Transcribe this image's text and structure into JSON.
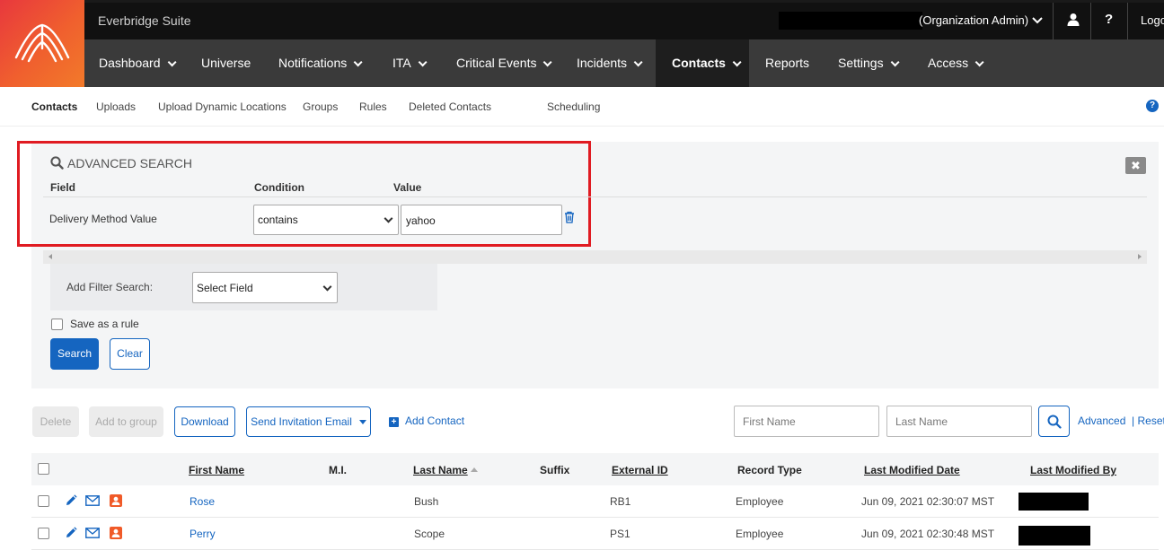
{
  "app": {
    "suite_title": "Everbridge Suite",
    "role_label": "(Organization Admin)",
    "logout_label": "Logo",
    "help_label": "?"
  },
  "nav": {
    "items": [
      {
        "label": "Dashboard",
        "caret": true
      },
      {
        "label": "Universe",
        "caret": false
      },
      {
        "label": "Notifications",
        "caret": true
      },
      {
        "label": "ITA",
        "caret": true
      },
      {
        "label": "Critical Events",
        "caret": true
      },
      {
        "label": "Incidents",
        "caret": true
      },
      {
        "label": "Contacts",
        "caret": true,
        "active": true
      },
      {
        "label": "Reports",
        "caret": false
      },
      {
        "label": "Settings",
        "caret": true
      },
      {
        "label": "Access",
        "caret": true
      }
    ]
  },
  "subnav": {
    "items": [
      "Contacts",
      "Uploads",
      "Upload Dynamic Locations",
      "Groups",
      "Rules",
      "Deleted Contacts",
      "Scheduling"
    ],
    "active": "Contacts",
    "help": "?"
  },
  "advanced_search": {
    "title": "ADVANCED SEARCH",
    "close": "✖",
    "headers": {
      "field": "Field",
      "condition": "Condition",
      "value": "Value"
    },
    "row": {
      "field": "Delivery Method Value",
      "condition": "contains",
      "value": "yahoo"
    },
    "add_filter_label": "Add Filter Search:",
    "add_filter_select": "Select Field",
    "save_rule_label": "Save as a rule",
    "search_button": "Search",
    "clear_button": "Clear"
  },
  "toolbar": {
    "delete": "Delete",
    "add_to_group": "Add to group",
    "download": "Download",
    "send_invitation": "Send Invitation Email",
    "add_contact": "Add Contact",
    "first_name_placeholder": "First Name",
    "last_name_placeholder": "Last Name",
    "advanced_link": "Advanced",
    "reset_link": "| Reset"
  },
  "table": {
    "columns": {
      "first_name": "First Name",
      "mi": "M.I.",
      "last_name": "Last Name",
      "suffix": "Suffix",
      "external_id": "External ID",
      "record_type": "Record Type",
      "last_modified_date": "Last Modified Date",
      "last_modified_by": "Last Modified By"
    },
    "rows": [
      {
        "first_name": "Rose",
        "last_name": "Bush",
        "external_id": "RB1",
        "record_type": "Employee",
        "last_modified_date": "Jun 09, 2021 02:30:07 MST"
      },
      {
        "first_name": "Perry",
        "last_name": "Scope",
        "external_id": "PS1",
        "record_type": "Employee",
        "last_modified_date": "Jun 09, 2021 02:30:48 MST"
      }
    ]
  },
  "colors": {
    "accent": "#1565c0",
    "highlight": "#e01b22",
    "nav_bg": "#3a3a3a",
    "top_bg": "#111111"
  },
  "icons": [
    "everbridge-logo-icon",
    "chevron-down-icon",
    "user-icon",
    "search-icon",
    "close-icon",
    "trash-icon",
    "plus-icon",
    "edit-icon",
    "email-icon",
    "contact-card-icon"
  ]
}
